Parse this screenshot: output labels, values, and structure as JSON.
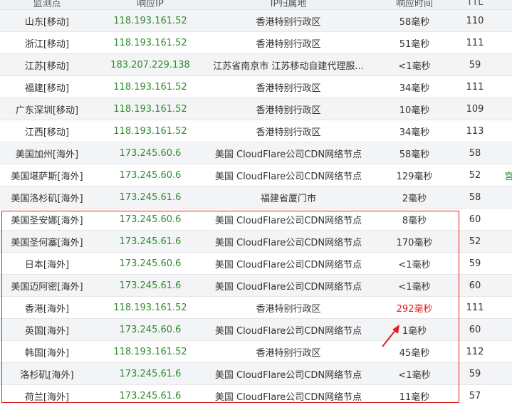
{
  "table": {
    "headers": [
      "监测点",
      "响应IP",
      "IP归属地",
      "响应时间",
      "TTL"
    ],
    "rows": [
      {
        "node": "山东[移动]",
        "ip": "118.193.161.52",
        "location": "香港特别行政区",
        "time": "58毫秒",
        "ttl": "110",
        "extra": ""
      },
      {
        "node": "浙江[移动]",
        "ip": "118.193.161.52",
        "location": "香港特别行政区",
        "time": "51毫秒",
        "ttl": "111",
        "extra": ""
      },
      {
        "node": "江苏[移动]",
        "ip": "183.207.229.138",
        "location": "江苏省南京市 江苏移动自建代理服...",
        "time": "<1毫秒",
        "ttl": "59",
        "extra": ""
      },
      {
        "node": "福建[移动]",
        "ip": "118.193.161.52",
        "location": "香港特别行政区",
        "time": "34毫秒",
        "ttl": "111",
        "extra": ""
      },
      {
        "node": "广东深圳[移动]",
        "ip": "118.193.161.52",
        "location": "香港特别行政区",
        "time": "10毫秒",
        "ttl": "109",
        "extra": ""
      },
      {
        "node": "江西[移动]",
        "ip": "118.193.161.52",
        "location": "香港特别行政区",
        "time": "34毫秒",
        "ttl": "113",
        "extra": ""
      },
      {
        "node": "美国加州[海外]",
        "ip": "173.245.60.6",
        "location": "美国 CloudFlare公司CDN网络节点",
        "time": "58毫秒",
        "ttl": "58",
        "extra": ""
      },
      {
        "node": "美国堪萨斯[海外]",
        "ip": "173.245.60.6",
        "location": "美国 CloudFlare公司CDN网络节点",
        "time": "129毫秒",
        "ttl": "52",
        "extra": "宫"
      },
      {
        "node": "美国洛杉矶[海外]",
        "ip": "173.245.61.6",
        "location": "福建省厦门市",
        "time": "2毫秒",
        "ttl": "58",
        "extra": ""
      },
      {
        "node": "美国圣安娜[海外]",
        "ip": "173.245.60.6",
        "location": "美国 CloudFlare公司CDN网络节点",
        "time": "8毫秒",
        "ttl": "60",
        "extra": ""
      },
      {
        "node": "美国圣何塞[海外]",
        "ip": "173.245.61.6",
        "location": "美国 CloudFlare公司CDN网络节点",
        "time": "170毫秒",
        "ttl": "52",
        "extra": ""
      },
      {
        "node": "日本[海外]",
        "ip": "173.245.60.6",
        "location": "美国 CloudFlare公司CDN网络节点",
        "time": "<1毫秒",
        "ttl": "59",
        "extra": ""
      },
      {
        "node": "美国迈阿密[海外]",
        "ip": "173.245.61.6",
        "location": "美国 CloudFlare公司CDN网络节点",
        "time": "<1毫秒",
        "ttl": "60",
        "extra": ""
      },
      {
        "node": "香港[海外]",
        "ip": "118.193.161.52",
        "location": "香港特别行政区",
        "time": "292毫秒",
        "ttl": "111",
        "extra": "",
        "slow": true
      },
      {
        "node": "英国[海外]",
        "ip": "173.245.60.6",
        "location": "美国 CloudFlare公司CDN网络节点",
        "time": "1毫秒",
        "ttl": "60",
        "extra": ""
      },
      {
        "node": "韩国[海外]",
        "ip": "118.193.161.52",
        "location": "香港特别行政区",
        "time": "45毫秒",
        "ttl": "112",
        "extra": ""
      },
      {
        "node": "洛杉矶[海外]",
        "ip": "173.245.61.6",
        "location": "美国 CloudFlare公司CDN网络节点",
        "time": "<1毫秒",
        "ttl": "59",
        "extra": ""
      },
      {
        "node": "荷兰[海外]",
        "ip": "173.245.61.6",
        "location": "美国 CloudFlare公司CDN网络节点",
        "time": "11毫秒",
        "ttl": "57",
        "extra": ""
      }
    ]
  },
  "colors": {
    "ip": "#2e8b2e",
    "slow_time": "#e0201c",
    "annotation": "#e0201c"
  }
}
